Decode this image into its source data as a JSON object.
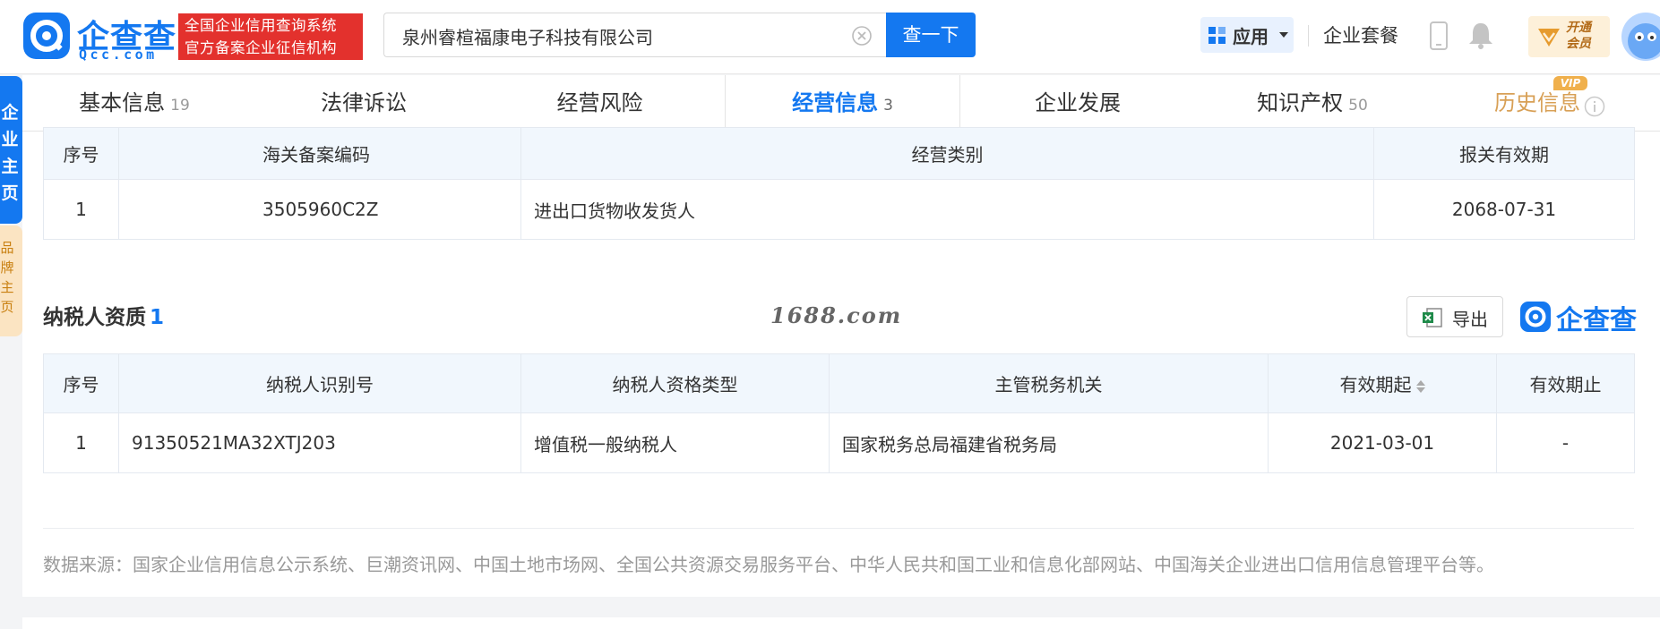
{
  "header": {
    "logo_text": "企查查",
    "logo_sub": "Qcc.com",
    "badge_line1": "全国企业信用查询系统",
    "badge_line2": "官方备案企业征信机构",
    "search_value": "泉州睿楦福康电子科技有限公司",
    "search_button": "查一下",
    "apps_label": "应用",
    "package_label": "企业套餐",
    "vip_line1": "开通",
    "vip_line2": "会员"
  },
  "side": {
    "main_label": "企业主页",
    "brand_label": "品牌主页"
  },
  "tabs": [
    {
      "label": "基本信息",
      "count": "19"
    },
    {
      "label": "法律诉讼",
      "count": ""
    },
    {
      "label": "经营风险",
      "count": ""
    },
    {
      "label": "经营信息",
      "count": "3"
    },
    {
      "label": "企业发展",
      "count": ""
    },
    {
      "label": "知识产权",
      "count": "50"
    },
    {
      "label": "历史信息",
      "count": ""
    }
  ],
  "vip_tag": "VIP",
  "customs_table": {
    "headers": [
      "序号",
      "海关备案编码",
      "经营类别",
      "报关有效期"
    ],
    "rows": [
      [
        "1",
        "3505960C2Z",
        "进出口货物收发货人",
        "2068-07-31"
      ]
    ]
  },
  "taxpayer": {
    "title": "纳税人资质",
    "count": "1",
    "watermark": "1688.com",
    "export_label": "导出",
    "brand_text": "企查查",
    "headers": [
      "序号",
      "纳税人识别号",
      "纳税人资格类型",
      "主管税务机关",
      "有效期起",
      "有效期止"
    ],
    "rows": [
      [
        "1",
        "91350521MA32XTJ203",
        "增值税一般纳税人",
        "国家税务总局福建省税务局",
        "2021-03-01",
        "-"
      ]
    ]
  },
  "source_text": "数据来源：国家企业信用信息公示系统、巨潮资讯网、中国土地市场网、全国公共资源交易服务平台、中华人民共和国工业和信息化部网站、中国海关企业进出口信用信息管理平台等。",
  "colors": {
    "brand_blue": "#1478f0",
    "badge_red": "#e3312d",
    "history_gold": "#d8a056",
    "header_bg": "#f1f7fd"
  }
}
